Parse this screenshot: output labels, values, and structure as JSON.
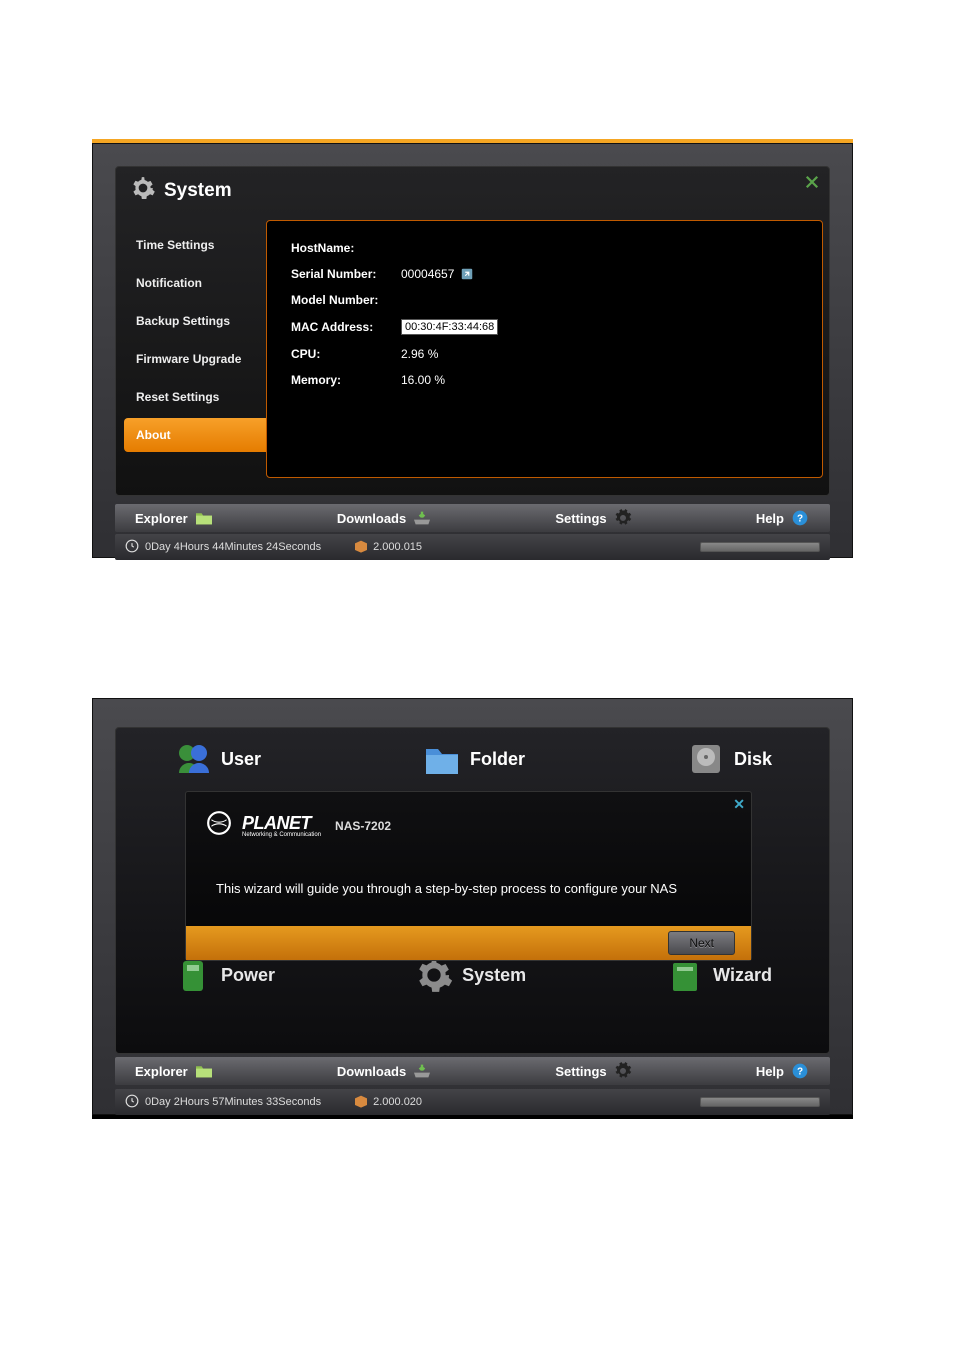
{
  "panel1": {
    "title": "System",
    "sidebar": [
      {
        "label": "Time Settings",
        "active": false
      },
      {
        "label": "Notification",
        "active": false
      },
      {
        "label": "Backup Settings",
        "active": false
      },
      {
        "label": "Firmware Upgrade",
        "active": false
      },
      {
        "label": "Reset Settings",
        "active": false
      },
      {
        "label": "About",
        "active": true
      }
    ],
    "info": {
      "hostname_label": "HostName:",
      "hostname_value": "",
      "serial_label": "Serial Number:",
      "serial_value": "00004657",
      "model_label": "Model Number:",
      "model_value": "",
      "mac_label": "MAC Address:",
      "mac_value": "00:30:4F:33:44:68",
      "cpu_label": "CPU:",
      "cpu_value": "2.96 %",
      "memory_label": "Memory:",
      "memory_value": "16.00 %"
    },
    "taskbar": {
      "explorer": "Explorer",
      "downloads": "Downloads",
      "settings": "Settings",
      "help": "Help"
    },
    "status": {
      "uptime": "0Day 4Hours 44Minutes 24Seconds",
      "version": "2.000.015"
    }
  },
  "panel2": {
    "grid_row1": [
      {
        "label": "User",
        "icon": "user"
      },
      {
        "label": "Folder",
        "icon": "folder"
      },
      {
        "label": "Disk",
        "icon": "disk"
      }
    ],
    "grid_row2": [
      {
        "label": "Power",
        "icon": "power"
      },
      {
        "label": "System",
        "icon": "system"
      },
      {
        "label": "Wizard",
        "icon": "wizard"
      }
    ],
    "wizard": {
      "brand": "PLANET",
      "brand_sub": "Networking & Communication",
      "model": "NAS-7202",
      "message": "This wizard will guide you through a step-by-step process to configure your NAS",
      "next": "Next"
    },
    "taskbar": {
      "explorer": "Explorer",
      "downloads": "Downloads",
      "settings": "Settings",
      "help": "Help"
    },
    "status": {
      "uptime": "0Day 2Hours 57Minutes 33Seconds",
      "version": "2.000.020"
    }
  },
  "icons": {
    "gear": "gear-icon",
    "close": "close-icon",
    "clock": "clock-icon",
    "box": "box-icon",
    "folder_sm": "folder-icon",
    "question": "question-icon"
  }
}
